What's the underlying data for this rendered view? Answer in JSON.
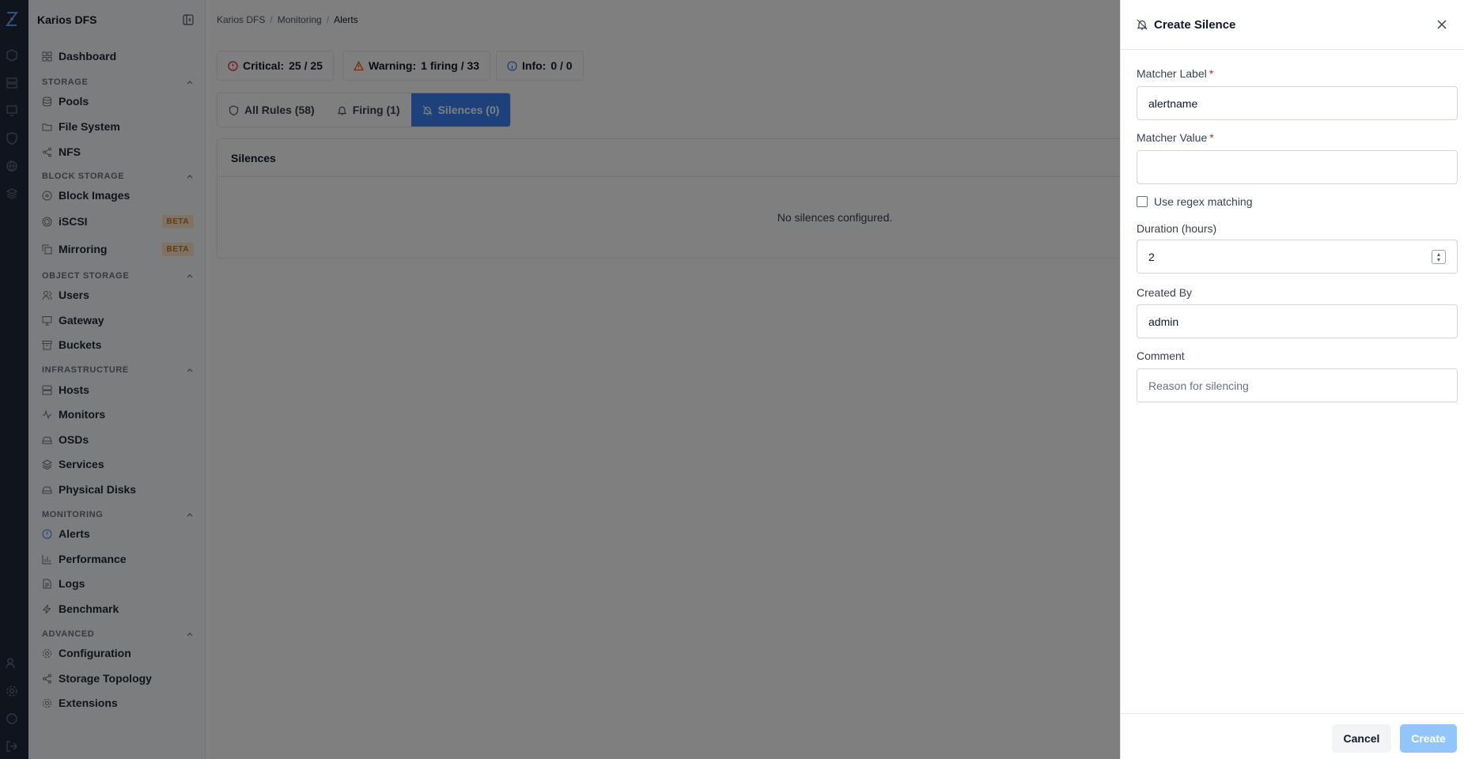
{
  "sidebar": {
    "title": "Karios DFS",
    "dashboard": "Dashboard",
    "sections": {
      "storage": "STORAGE",
      "block_storage": "BLOCK STORAGE",
      "object_storage": "OBJECT STORAGE",
      "infrastructure": "INFRASTRUCTURE",
      "monitoring": "MONITORING",
      "advanced": "ADVANCED"
    },
    "items": {
      "pools": "Pools",
      "file_system": "File System",
      "nfs": "NFS",
      "block_images": "Block Images",
      "iscsi": "iSCSI",
      "mirroring": "Mirroring",
      "users": "Users",
      "gateway": "Gateway",
      "buckets": "Buckets",
      "hosts": "Hosts",
      "monitors": "Monitors",
      "osds": "OSDs",
      "services": "Services",
      "physical_disks": "Physical Disks",
      "alerts": "Alerts",
      "performance": "Performance",
      "logs": "Logs",
      "benchmark": "Benchmark",
      "configuration": "Configuration",
      "storage_topology": "Storage Topology",
      "extensions": "Extensions"
    },
    "beta_label": "BETA"
  },
  "breadcrumb": [
    "Karios DFS",
    "Monitoring",
    "Alerts"
  ],
  "breadcrumb_sep": "/",
  "stats": {
    "critical_label": "Critical:",
    "critical_value": "25 / 25",
    "warning_label": "Warning:",
    "warning_value": "1 firing / 33",
    "info_label": "Info:",
    "info_value": "0 / 0"
  },
  "tabs": {
    "all_rules": "All Rules (58)",
    "firing": "Firing (1)",
    "silences": "Silences (0)"
  },
  "silences_card": {
    "title": "Silences",
    "empty": "No silences configured."
  },
  "drawer": {
    "title": "Create Silence",
    "matcher_label": "Matcher Label",
    "matcher_label_value": "alertname",
    "matcher_value": "Matcher Value",
    "matcher_value_value": "",
    "required_mark": "*",
    "regex_label": "Use regex matching",
    "duration_label": "Duration (hours)",
    "duration_value": "2",
    "created_by_label": "Created By",
    "created_by_value": "admin",
    "comment_label": "Comment",
    "comment_placeholder": "Reason for silencing",
    "cancel": "Cancel",
    "create": "Create"
  },
  "colors": {
    "accent": "#3b82f6",
    "critical": "#dc2626",
    "warning": "#ea580c",
    "info": "#3b82f6",
    "beta_bg": "#fde7c8",
    "rail": "#1e293b"
  }
}
